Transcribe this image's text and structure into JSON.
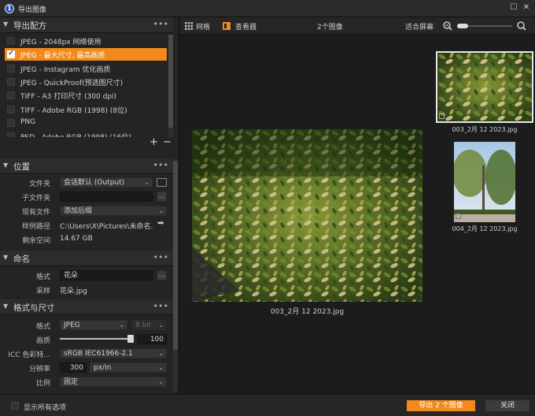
{
  "window": {
    "title": "导出图像"
  },
  "presets": {
    "title": "导出配方",
    "items": [
      {
        "label": "JPEG - 2048px 网络使用",
        "checked": false
      },
      {
        "label": "JPEG - 最大尺寸, 最高画质",
        "checked": true
      },
      {
        "label": "JPEG - Instagram 优化画质",
        "checked": false
      },
      {
        "label": "JPEG - QuickProof(预选图尺寸)",
        "checked": false
      },
      {
        "label": "TIFF - A3 打印尺寸 (300 dpi)",
        "checked": false
      },
      {
        "label": "TIFF - Adobe RGB (1998) (8位)",
        "checked": false
      },
      {
        "label": "PNG",
        "checked": false
      },
      {
        "label": "PSD - Adobe RGB (1998) (16位)",
        "checked": false
      }
    ],
    "add": "+",
    "remove": "−"
  },
  "location": {
    "title": "位置",
    "folder_label": "文件夹",
    "folder_value": "会话默认 (Output)",
    "subfolder_label": "子文件夹",
    "subfolder_value": "",
    "existing_label": "现有文件",
    "existing_value": "添加后缀",
    "sample_path_label": "样例路径",
    "sample_path_value": "C:\\Users\\X\\Pictures\\未命名...",
    "free_space_label": "剩余空间",
    "free_space_value": "14.67 GB"
  },
  "naming": {
    "title": "命名",
    "format_label": "格式",
    "format_value": "花朵",
    "sample_label": "采样",
    "sample_value": "花朵.jpg"
  },
  "format_size": {
    "title": "格式与尺寸",
    "format_label": "格式",
    "format_value": "JPEG",
    "bit_value": "8 bit",
    "quality_label": "画质",
    "quality_value": "100",
    "quality_fraction": 1.0,
    "icc_label": "ICC 色彩特...",
    "icc_value": "sRGB IEC61966-2.1",
    "resolution_label": "分辨率",
    "resolution_value": "300",
    "resolution_unit": "px/in",
    "scale_label": "比例",
    "scale_value": "固定"
  },
  "toolbar": {
    "grid_label": "网格",
    "viewer_label": "查看器",
    "count_label": "2个图像",
    "fit_label": "适合屏幕"
  },
  "viewer": {
    "main_caption": "003_2月 12 2023.jpg",
    "thumbs": [
      {
        "caption": "003_2月 12 2023.jpg",
        "selected": true
      },
      {
        "caption": "004_2月 12 2023.jpg",
        "selected": false
      }
    ]
  },
  "footer": {
    "show_all_label": "显示所有选项",
    "export_label": "导出 2 个图像",
    "close_label": "关闭"
  }
}
